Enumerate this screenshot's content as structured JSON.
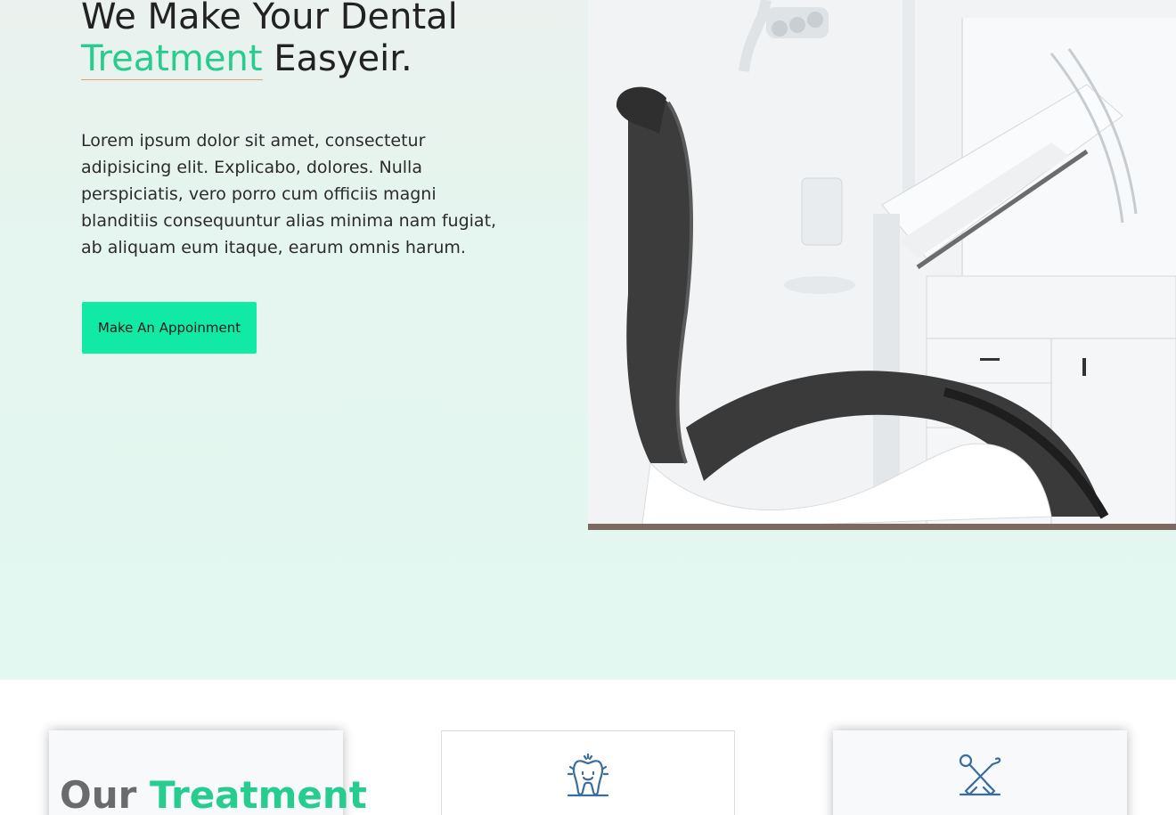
{
  "hero": {
    "title_line1": "We Make Your Dental",
    "title_accent": "Treatment",
    "title_rest": " Easyeir.",
    "description": "Lorem ipsum dolor sit amet, consectetur adipisicing elit. Explicabo, dolores. Nulla perspiciatis, vero porro cum officiis magni blanditiis consequuntur alias minima nam fugiat, ab aliquam eum itaque, earum omnis harum.",
    "cta_label": "Make An Appoinment",
    "image": "dental-chair-photo"
  },
  "services": {
    "heading_prefix": "Our ",
    "heading_accent": "Treatment",
    "cards": [
      {
        "icon": "tooth-icon"
      },
      {
        "icon": "dental-tools-icon"
      }
    ]
  },
  "colors": {
    "accent": "#27cc8f",
    "button": "#11eaa4",
    "icon": "#3a6c9c",
    "underline": "#d9a36b"
  }
}
